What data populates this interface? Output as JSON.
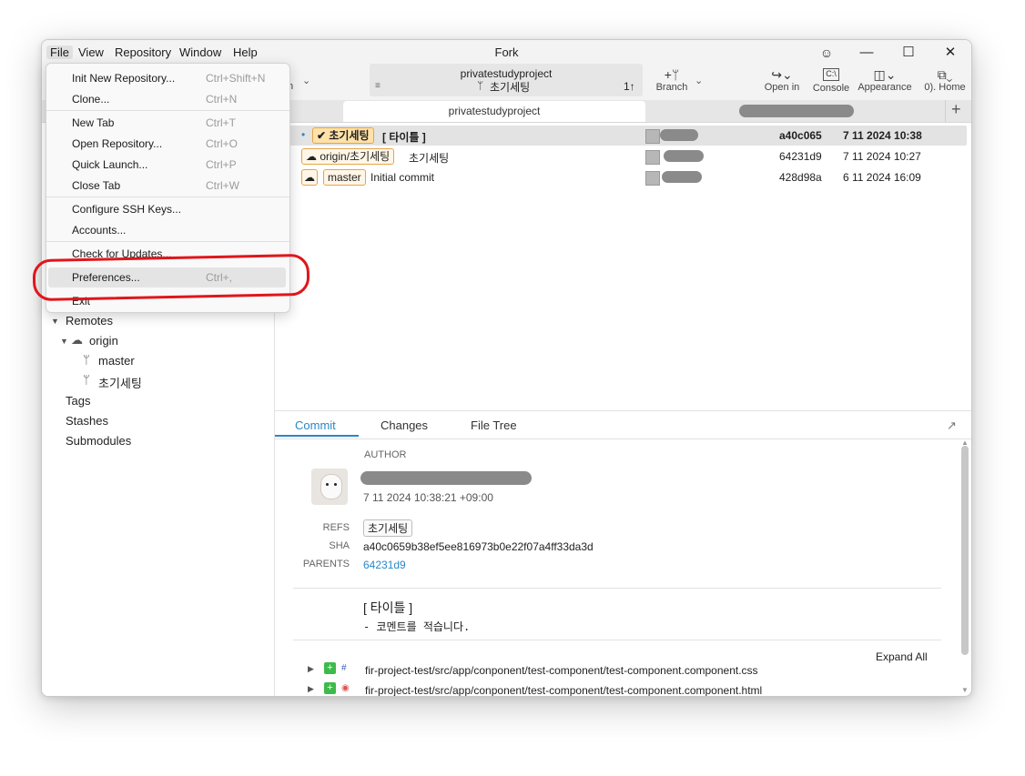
{
  "window": {
    "title": "Fork"
  },
  "menubar": [
    "File",
    "View",
    "Repository",
    "Window",
    "Help"
  ],
  "toolbar": {
    "repo_name": "privatestudyproject",
    "branch_name": "초기세팅",
    "ahead": "1↑",
    "partial_left": "h",
    "branch_label": "Branch",
    "open_in_label": "Open in",
    "console_label": "Console",
    "appearance_label": "Appearance",
    "home_label": "0). Home"
  },
  "tabs": {
    "active": "privatestudyproject"
  },
  "file_menu": {
    "items": [
      {
        "label": "Init New Repository...",
        "shortcut": "Ctrl+Shift+N"
      },
      {
        "label": "Clone...",
        "shortcut": "Ctrl+N"
      },
      {
        "label": "New Tab",
        "shortcut": "Ctrl+T"
      },
      {
        "label": "Open Repository...",
        "shortcut": "Ctrl+O"
      },
      {
        "label": "Quick Launch...",
        "shortcut": "Ctrl+P"
      },
      {
        "label": "Close Tab",
        "shortcut": "Ctrl+W"
      },
      {
        "label": "Configure SSH Keys...",
        "shortcut": ""
      },
      {
        "label": "Accounts...",
        "shortcut": ""
      },
      {
        "label": "Check for Updates...",
        "shortcut": ""
      },
      {
        "label": "Preferences...",
        "shortcut": "Ctrl+,"
      },
      {
        "label": "Exit",
        "shortcut": ""
      }
    ]
  },
  "sidebar": {
    "remotes": "Remotes",
    "origin": "origin",
    "branches": [
      "master",
      "초기세팅"
    ],
    "tags": "Tags",
    "stashes": "Stashes",
    "submodules": "Submodules"
  },
  "commits": [
    {
      "refs": [
        "초기세팅"
      ],
      "message": "[ 타이틀 ]",
      "sha": "a40c065",
      "date": "7 11 2024 10:38"
    },
    {
      "refs": [
        "origin/초기세팅"
      ],
      "message": "초기세팅",
      "sha": "64231d9",
      "date": "7 11 2024 10:27"
    },
    {
      "refs": [
        "master"
      ],
      "message": "Initial commit",
      "sha": "428d98a",
      "date": "6 11 2024 16:09"
    }
  ],
  "detail": {
    "tabs": [
      "Commit",
      "Changes",
      "File Tree"
    ],
    "author_label": "AUTHOR",
    "author_date": "7 11 2024 10:38:21 +09:00",
    "refs_label": "REFS",
    "refs_value": "초기세팅",
    "sha_label": "SHA",
    "sha_value": "a40c0659b38ef5ee816973b0e22f07a4ff33da3d",
    "parents_label": "PARENTS",
    "parents_value": "64231d9",
    "message_title": "[ 타이틀 ]",
    "message_body": "- 코멘트를 적습니다.",
    "expand_all": "Expand All",
    "files": [
      "fir-project-test/src/app/conponent/test-component/test-component.component.css",
      "fir-project-test/src/app/conponent/test-component/test-component.component.html"
    ]
  },
  "colors": {
    "accent": "#2b86c5",
    "ref_border": "#e5a44a",
    "highlight": "#e0161b"
  }
}
